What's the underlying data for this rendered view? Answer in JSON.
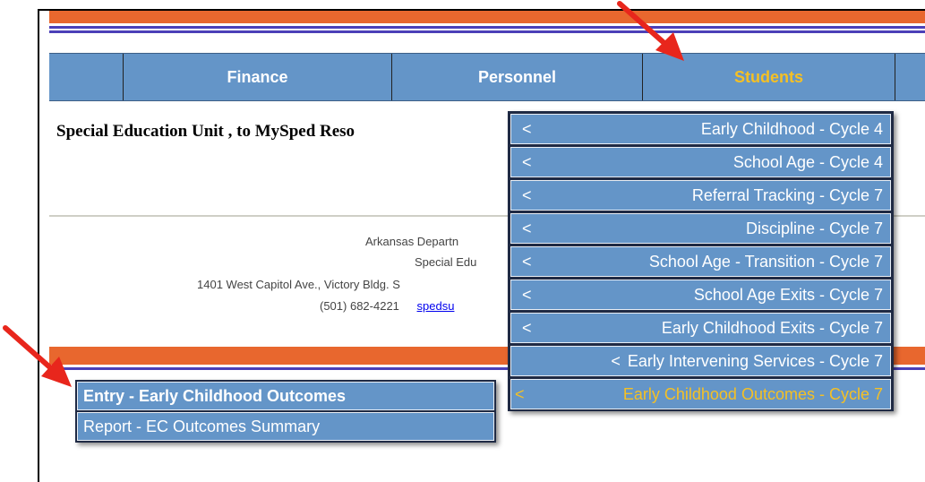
{
  "nav": {
    "items": [
      {
        "label": ""
      },
      {
        "label": "Finance"
      },
      {
        "label": "Personnel"
      },
      {
        "label": "Students"
      },
      {
        "label": ""
      }
    ]
  },
  "heading": "Special Education Unit , to MySped Reso",
  "footer": {
    "line1": "Arkansas Departn",
    "line2": "Special Edu",
    "line3": "1401 West Capitol Ave., Victory Bldg. S",
    "phone": "(501) 682-4221",
    "link": "spedsu"
  },
  "dropdown": {
    "items": [
      {
        "prefix": "<",
        "label": "Early Childhood - Cycle 4"
      },
      {
        "prefix": "<",
        "label": "School Age - Cycle 4"
      },
      {
        "prefix": "<",
        "label": "Referral Tracking - Cycle 7"
      },
      {
        "prefix": "<",
        "label": "Discipline - Cycle 7"
      },
      {
        "prefix": "<",
        "label": "School Age - Transition - Cycle 7"
      },
      {
        "prefix": "<",
        "label": "School Age Exits - Cycle 7"
      },
      {
        "prefix": "<",
        "label": "Early Childhood Exits - Cycle 7"
      },
      {
        "prefix": "<",
        "label": "Early Intervening Services - Cycle 7"
      },
      {
        "prefix": "<",
        "label": "Early Childhood Outcomes - Cycle 7"
      }
    ]
  },
  "submenu": {
    "items": [
      {
        "label": "Entry - Early Childhood Outcomes"
      },
      {
        "label": "Report - EC Outcomes Summary"
      }
    ]
  },
  "colors": {
    "nav_blue": "#6495c8",
    "active_yellow": "#f5c024",
    "stripe_orange": "#e8672e",
    "stripe_blue": "#4b40b8",
    "arrow_red": "#e8261c"
  },
  "icons": {
    "pointer": "red-arrow-icon"
  }
}
